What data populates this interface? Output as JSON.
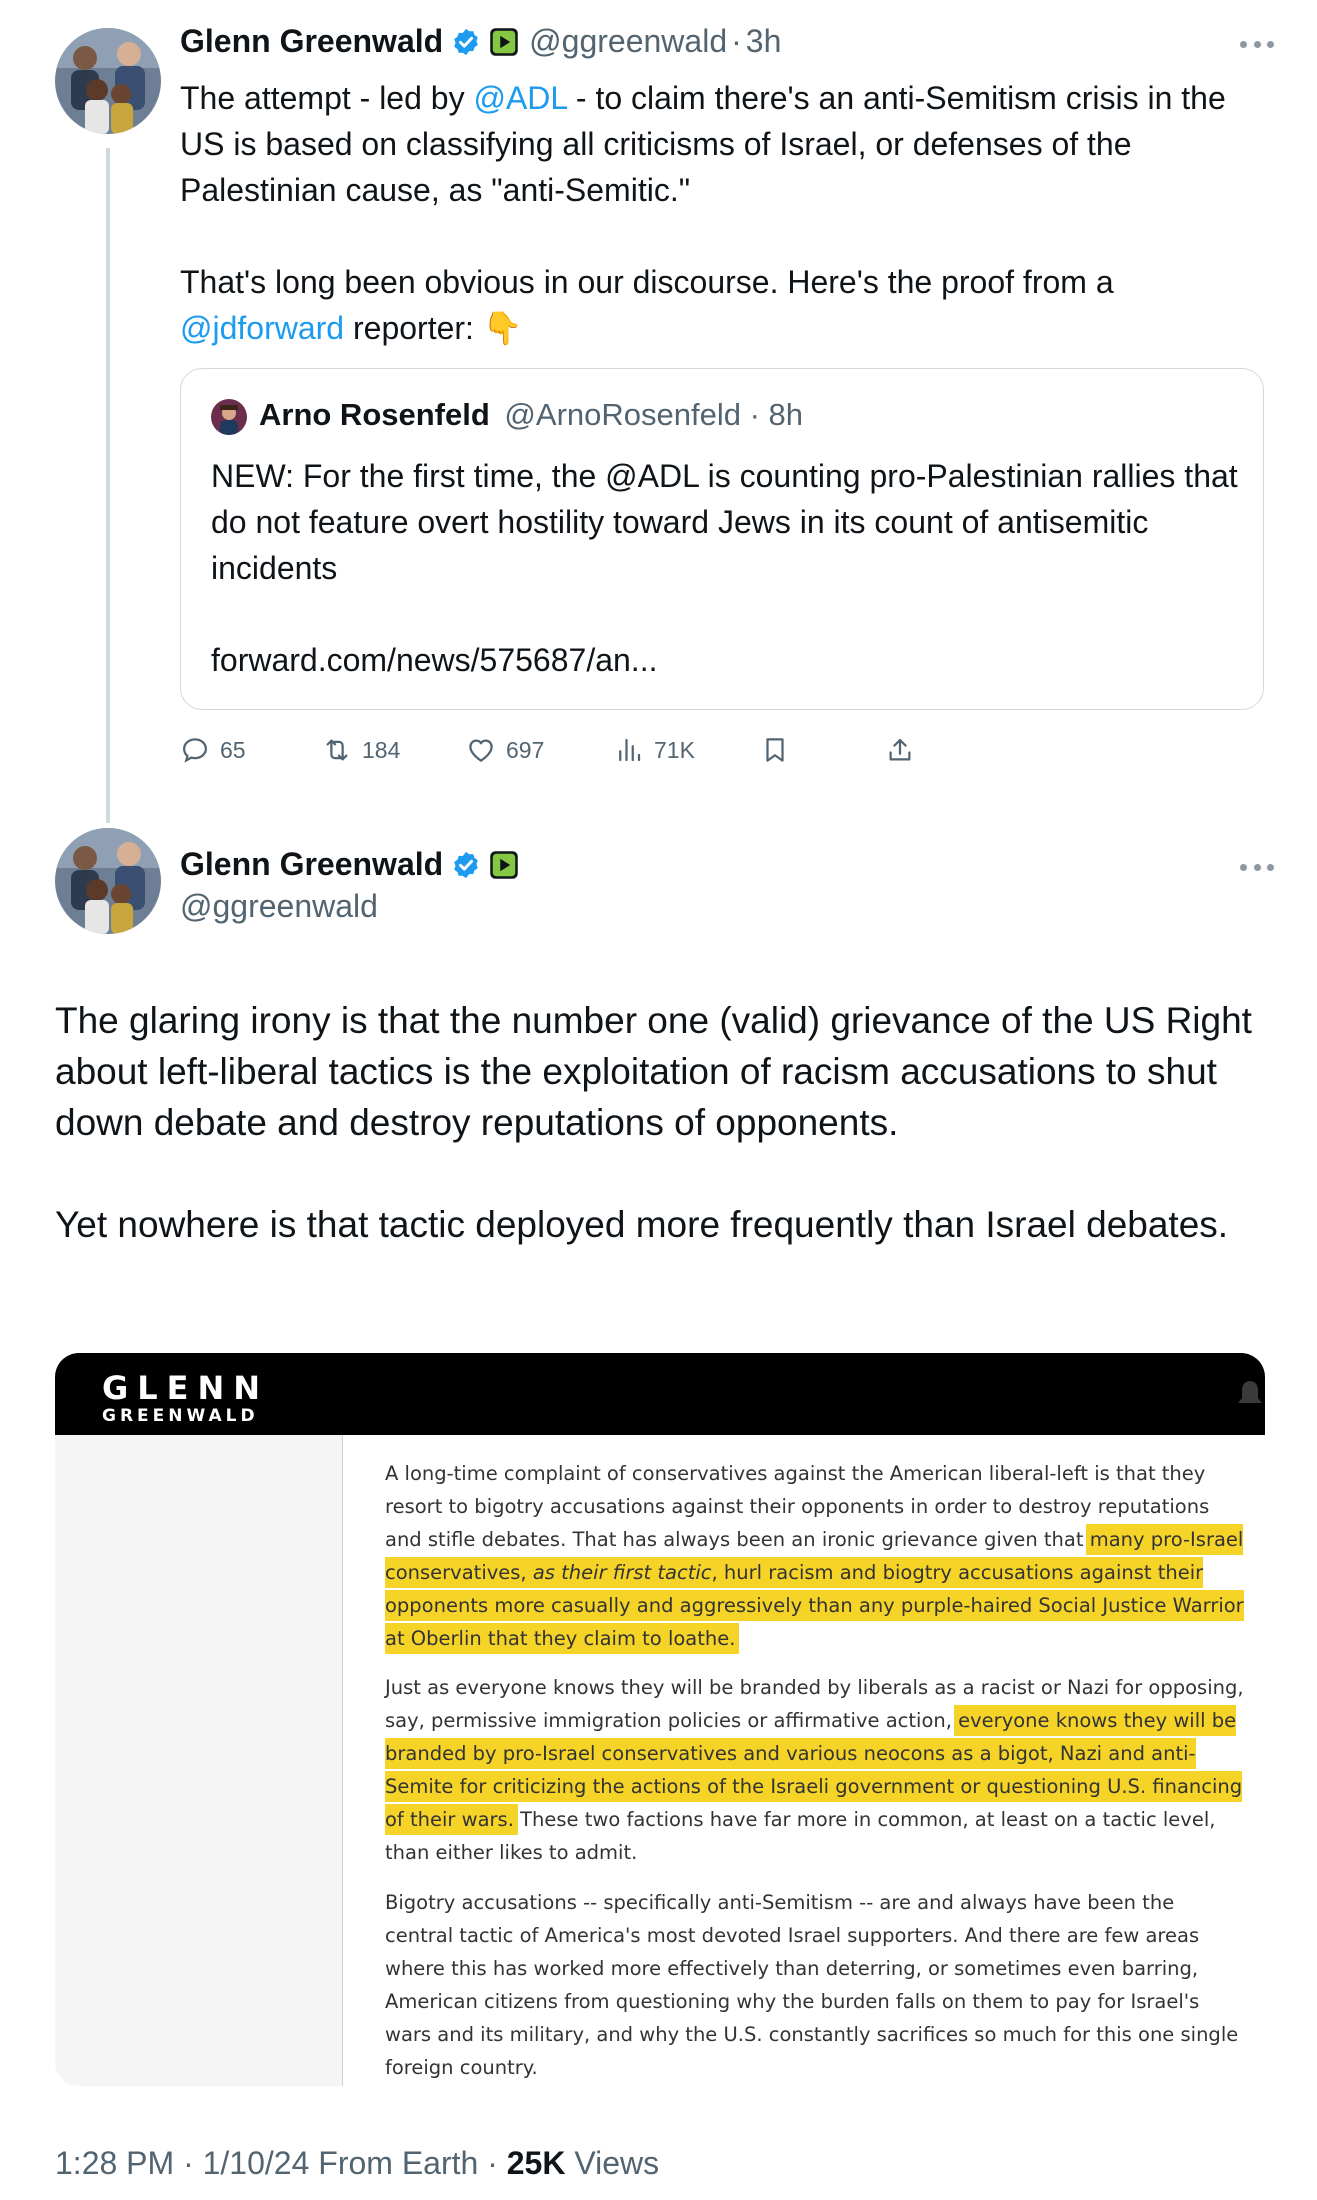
{
  "tweet1": {
    "display_name": "Glenn Greenwald",
    "handle": "@ggreenwald",
    "time": "3h",
    "text_pre": "The attempt - led by ",
    "mention_adl": "@ADL",
    "text_mid": " - to claim there's an anti-Semitism crisis in the US is based on classifying all criticisms of Israel, or defenses of the Palestinian cause, as \"anti-Semitic.\"",
    "text_para2": "That's long been obvious in our discourse. Here's the proof from a ",
    "mention_jdf": "@jdforward",
    "text_end": " reporter: ",
    "emoji": "👇",
    "quote": {
      "display_name": "Arno Rosenfeld",
      "handle": "@ArnoRosenfeld",
      "time": "8h",
      "text": "NEW: For the first time, the @ADL is counting pro-Palestinian rallies that do not feature overt hostility toward Jews in its count of antisemitic incidents",
      "link": "forward.com/news/575687/an..."
    },
    "actions": {
      "replies": "65",
      "reposts": "184",
      "likes": "697",
      "views": "71K"
    }
  },
  "tweet2": {
    "display_name": "Glenn Greenwald",
    "handle": "@ggreenwald",
    "text_p1": "The glaring irony is that the number one (valid) grievance of the US Right about left-liberal tactics is the exploitation of racism accusations to shut down debate and destroy reputations of opponents.",
    "text_p2": "Yet nowhere is that tactic deployed more frequently than Israel debates.",
    "image": {
      "logo_top": "GLENN",
      "logo_bottom": "GREENWALD",
      "p1_a": "A long-time complaint of conservatives against the American liberal-left is that they resort to bigotry accusations against their opponents in order to destroy reputations and stifle debates. That has always been an ironic grievance given that ",
      "p1_hl_a": "many pro-Israel conservatives, ",
      "p1_hl_em": "as their first tactic",
      "p1_hl_b": ", hurl racism and biogtry accusations against their opponents more casually and aggressively than any purple-haired Social Justice Warrior at Oberlin that they claim to loathe.",
      "p2_a": "Just as everyone knows they will be branded by liberals as a racist or Nazi for opposing, say, permissive immigration policies or affirmative action, ",
      "p2_hl": "everyone knows they will be branded by pro-Israel conservatives and various neocons as a bigot, Nazi and anti-Semite for criticizing the actions of the Israeli government or questioning U.S. financing of their wars.",
      "p2_b": " These two factions have far more in common, at least on a tactic level, than either likes to admit.",
      "p3": "Bigotry accusations -- specifically anti-Semitism -- are and always have been the central tactic of America's most devoted Israel supporters. And there are few areas where this has worked more effectively than deterring, or sometimes even barring, American citizens from questioning why the burden falls on them to pay for Israel's wars and its military, and why the U.S. constantly sacrifices so much for this one single foreign country."
    },
    "footer": {
      "time": "1:28 PM",
      "date": "1/10/24",
      "source": "From Earth",
      "views_count": "25K",
      "views_label": "Views"
    }
  },
  "colors": {
    "link": "#1d9bf0",
    "muted": "#536471",
    "highlight": "#f5d327",
    "verified": "#1d9bf0",
    "rumble": "#85c742"
  },
  "icons": [
    "verified-badge-icon",
    "rumble-badge-icon",
    "more-icon",
    "reply-icon",
    "repost-icon",
    "like-icon",
    "views-icon",
    "bookmark-icon",
    "share-icon",
    "bell-icon"
  ]
}
